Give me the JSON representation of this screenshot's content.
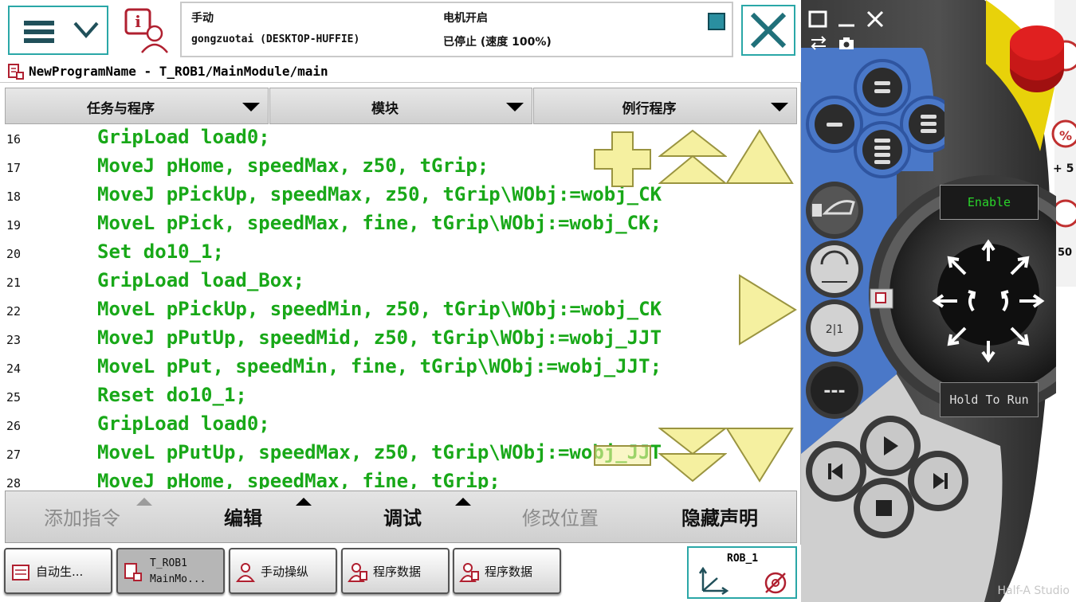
{
  "status": {
    "mode": "手动",
    "controller": "gongzuotai (DESKTOP-HUFFIE)",
    "motor": "电机开启",
    "run_state": "已停止 (速度 100%)"
  },
  "path": "NewProgramName - T_ROB1/MainModule/main",
  "tabs": [
    {
      "label": "任务与程序"
    },
    {
      "label": "模块"
    },
    {
      "label": "例行程序"
    }
  ],
  "code_lines": [
    {
      "num": "16",
      "text": "GripLoad load0;"
    },
    {
      "num": "17",
      "text": "MoveJ pHome, speedMax, z50, tGrip;"
    },
    {
      "num": "18",
      "text": "MoveJ pPickUp, speedMax, z50, tGrip\\WObj:=wobj_CK"
    },
    {
      "num": "19",
      "text": "MoveL pPick, speedMax, fine, tGrip\\WObj:=wobj_CK;"
    },
    {
      "num": "20",
      "text": "Set do10_1;"
    },
    {
      "num": "21",
      "text": "GripLoad load_Box;"
    },
    {
      "num": "22",
      "text": "MoveL pPickUp, speedMin, z50, tGrip\\WObj:=wobj_CK"
    },
    {
      "num": "23",
      "text": "MoveJ pPutUp, speedMid, z50, tGrip\\WObj:=wobj_JJT"
    },
    {
      "num": "24",
      "text": "MoveL pPut, speedMin, fine, tGrip\\WObj:=wobj_JJT;"
    },
    {
      "num": "25",
      "text": "Reset do10_1;"
    },
    {
      "num": "26",
      "text": "GripLoad load0;"
    },
    {
      "num": "27",
      "text": "MoveL pPutUp, speedMax, z50, tGrip\\WObj:=wobj_JJT"
    },
    {
      "num": "28",
      "text": "MoveJ pHome, speedMax, fine, tGrip;"
    }
  ],
  "commands": {
    "add_instruction": "添加指令",
    "edit": "编辑",
    "debug": "调试",
    "modify_position": "修改位置",
    "hide_declarations": "隐藏声明"
  },
  "taskbar": {
    "auto": "自动生...",
    "program": "T_ROB1\nMainMo...",
    "jogging": "手动操纵",
    "data1": "程序数据",
    "data2": "程序数据",
    "robot": "ROB_1"
  },
  "device": {
    "enable": "Enable",
    "hold_to_run": "Hold To Run",
    "plus5": "+ 5",
    "fifty": "50"
  },
  "watermark": "Half-A Studio",
  "colors": {
    "code_green": "#18a818",
    "accent_teal": "#2aa7a7",
    "jog_yellow": "#f5f0a0",
    "device_blue": "#4a78c8"
  }
}
